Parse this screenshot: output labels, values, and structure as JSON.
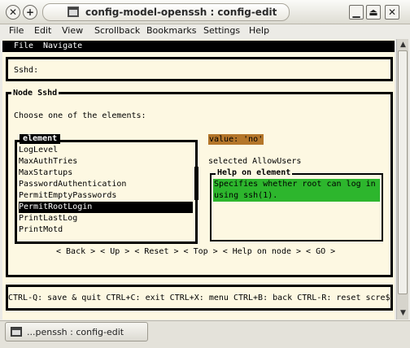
{
  "window": {
    "title": "config-model-openssh : config-edit",
    "buttons": {
      "close": "✕",
      "new": "+",
      "minimize": "▁",
      "maximize": "⏏",
      "close_right": "✕"
    }
  },
  "menubar": [
    "File",
    "Edit",
    "View",
    "Scrollback",
    "Bookmarks",
    "Settings",
    "Help"
  ],
  "terminal": {
    "top_menu": [
      "File",
      "Navigate"
    ],
    "path": "Sshd:",
    "node_title": "Node Sshd",
    "prompt": "Choose one of the elements:",
    "list_title": "element",
    "elements": [
      "LogLevel",
      "MaxAuthTries",
      "MaxStartups",
      "PasswordAuthentication",
      "PermitEmptyPasswords",
      "PermitRootLogin",
      "PrintLastLog",
      "PrintMotd"
    ],
    "selected_element": "PermitRootLogin",
    "value_label": "value: 'no'",
    "selected_text": "selected AllowUsers",
    "help_title": "Help on element",
    "help_text": "Specifies whether root can log in using ssh(1).",
    "nav": "< Back > < Up > < Reset > < Top > < Help on node > < GO >",
    "status_line": "CTRL-Q: save & quit CTRL+C: exit CTRL+X: menu CTRL+B: back CTRL-R: reset scre$"
  },
  "colors": {
    "value_bg": "#b4762a",
    "help_bg": "#2db62d",
    "terminal_bg": "#fdf8e2"
  },
  "taskbar": {
    "task_label": "...penssh : config-edit"
  }
}
